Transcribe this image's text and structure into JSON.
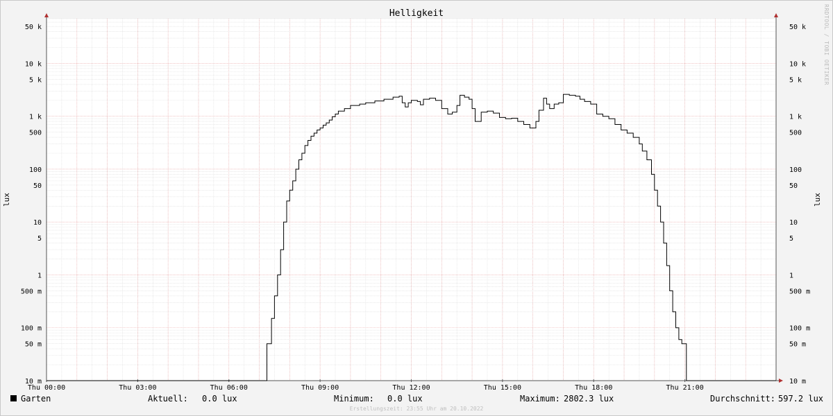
{
  "chart_data": {
    "type": "line",
    "title": "Helligkeit",
    "ylabel": "lux",
    "scale": "log",
    "ylim": [
      0.01,
      70000
    ],
    "xlim_hours": [
      0,
      24
    ],
    "grid": true,
    "x_ticks": [
      {
        "h": 0,
        "label": "Thu 00:00"
      },
      {
        "h": 3,
        "label": "Thu 03:00"
      },
      {
        "h": 6,
        "label": "Thu 06:00"
      },
      {
        "h": 9,
        "label": "Thu 09:00"
      },
      {
        "h": 12,
        "label": "Thu 12:00"
      },
      {
        "h": 15,
        "label": "Thu 15:00"
      },
      {
        "h": 18,
        "label": "Thu 18:00"
      },
      {
        "h": 21,
        "label": "Thu 21:00"
      }
    ],
    "y_ticks": [
      {
        "v": 0.01,
        "label": "10 m"
      },
      {
        "v": 0.05,
        "label": "50 m"
      },
      {
        "v": 0.1,
        "label": "100 m"
      },
      {
        "v": 0.5,
        "label": "500 m"
      },
      {
        "v": 1,
        "label": "1"
      },
      {
        "v": 5,
        "label": "5"
      },
      {
        "v": 10,
        "label": "10"
      },
      {
        "v": 50,
        "label": "50"
      },
      {
        "v": 100,
        "label": "100"
      },
      {
        "v": 500,
        "label": "500"
      },
      {
        "v": 1000,
        "label": "1 k"
      },
      {
        "v": 5000,
        "label": "5 k"
      },
      {
        "v": 10000,
        "label": "10 k"
      },
      {
        "v": 50000,
        "label": "50 k"
      }
    ],
    "series": [
      {
        "name": "Garten",
        "color": "#000000",
        "points": [
          [
            0,
            0.01
          ],
          [
            7.2,
            0.01
          ],
          [
            7.25,
            0.05
          ],
          [
            7.35,
            0.05
          ],
          [
            7.4,
            0.15
          ],
          [
            7.5,
            0.4
          ],
          [
            7.6,
            1
          ],
          [
            7.7,
            3
          ],
          [
            7.8,
            10
          ],
          [
            7.9,
            25
          ],
          [
            8.0,
            40
          ],
          [
            8.1,
            60
          ],
          [
            8.2,
            100
          ],
          [
            8.3,
            150
          ],
          [
            8.4,
            200
          ],
          [
            8.5,
            280
          ],
          [
            8.6,
            350
          ],
          [
            8.7,
            420
          ],
          [
            8.8,
            480
          ],
          [
            8.9,
            550
          ],
          [
            9.0,
            600
          ],
          [
            9.1,
            680
          ],
          [
            9.2,
            750
          ],
          [
            9.3,
            850
          ],
          [
            9.4,
            980
          ],
          [
            9.5,
            1100
          ],
          [
            9.6,
            1250
          ],
          [
            9.8,
            1400
          ],
          [
            10.0,
            1600
          ],
          [
            10.3,
            1700
          ],
          [
            10.5,
            1800
          ],
          [
            10.8,
            1950
          ],
          [
            11.1,
            2100
          ],
          [
            11.4,
            2300
          ],
          [
            11.6,
            2400
          ],
          [
            11.7,
            1800
          ],
          [
            11.8,
            1500
          ],
          [
            11.9,
            1800
          ],
          [
            12.0,
            2000
          ],
          [
            12.2,
            1900
          ],
          [
            12.3,
            1650
          ],
          [
            12.4,
            2100
          ],
          [
            12.6,
            2200
          ],
          [
            12.8,
            2000
          ],
          [
            13.0,
            1400
          ],
          [
            13.2,
            1100
          ],
          [
            13.35,
            1200
          ],
          [
            13.5,
            1600
          ],
          [
            13.6,
            2500
          ],
          [
            13.75,
            2300
          ],
          [
            13.9,
            2100
          ],
          [
            14.0,
            1400
          ],
          [
            14.1,
            800
          ],
          [
            14.3,
            1200
          ],
          [
            14.5,
            1250
          ],
          [
            14.7,
            1150
          ],
          [
            14.9,
            950
          ],
          [
            15.1,
            900
          ],
          [
            15.3,
            920
          ],
          [
            15.5,
            800
          ],
          [
            15.7,
            700
          ],
          [
            15.9,
            600
          ],
          [
            16.1,
            800
          ],
          [
            16.2,
            1300
          ],
          [
            16.35,
            2200
          ],
          [
            16.45,
            1700
          ],
          [
            16.55,
            1400
          ],
          [
            16.7,
            1700
          ],
          [
            16.85,
            1800
          ],
          [
            17.0,
            2600
          ],
          [
            17.2,
            2500
          ],
          [
            17.4,
            2400
          ],
          [
            17.55,
            2100
          ],
          [
            17.7,
            1900
          ],
          [
            17.9,
            1700
          ],
          [
            18.1,
            1100
          ],
          [
            18.3,
            1000
          ],
          [
            18.5,
            900
          ],
          [
            18.7,
            700
          ],
          [
            18.9,
            550
          ],
          [
            19.1,
            480
          ],
          [
            19.3,
            400
          ],
          [
            19.5,
            300
          ],
          [
            19.6,
            220
          ],
          [
            19.75,
            150
          ],
          [
            19.9,
            80
          ],
          [
            20.0,
            40
          ],
          [
            20.1,
            20
          ],
          [
            20.2,
            10
          ],
          [
            20.3,
            4
          ],
          [
            20.4,
            1.5
          ],
          [
            20.5,
            0.5
          ],
          [
            20.6,
            0.2
          ],
          [
            20.7,
            0.1
          ],
          [
            20.8,
            0.06
          ],
          [
            20.9,
            0.05
          ],
          [
            21.0,
            0.05
          ],
          [
            21.05,
            0.01
          ],
          [
            24.0,
            0.01
          ]
        ]
      }
    ]
  },
  "legend": {
    "series_name": "Garten",
    "current_label": "Aktuell:",
    "current_value": "0.0 lux",
    "min_label": "Minimum:",
    "min_value": "0.0 lux",
    "max_label": "Maximum:",
    "max_value": "2802.3 lux",
    "avg_label": "Durchschnitt:",
    "avg_value": "597.2 lux"
  },
  "footer": "Erstellungszeit: 23:55 Uhr am 20.10.2022",
  "watermark": "RRDTOOL / TOBI OETIKER"
}
